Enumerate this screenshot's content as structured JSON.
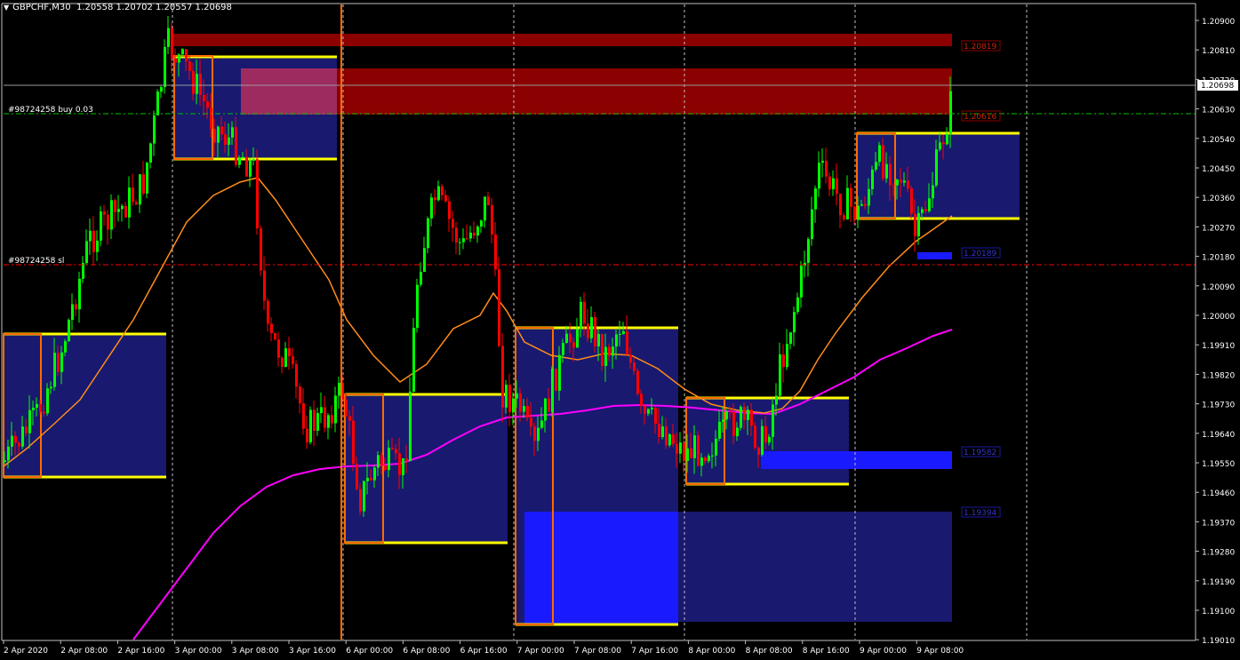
{
  "header": {
    "symbol_timeframe": "GBPCHF,M30",
    "ohlc": "1.20558 1.20702 1.20557 1.20698",
    "dropdown_glyph": "▼"
  },
  "price_scale": {
    "labels": [
      "1.20900",
      "1.20810",
      "1.20720",
      "1.20630",
      "1.20540",
      "1.20450",
      "1.20360",
      "1.20270",
      "1.20180",
      "1.20090",
      "1.20000",
      "1.19910",
      "1.19820",
      "1.19730",
      "1.19640",
      "1.19550",
      "1.19460",
      "1.19370",
      "1.19280",
      "1.19190",
      "1.19100",
      "1.19010"
    ],
    "current_price": "1.20698"
  },
  "time_scale": {
    "labels": [
      "2 Apr 2020",
      "2 Apr 08:00",
      "2 Apr 16:00",
      "3 Apr 00:00",
      "3 Apr 08:00",
      "3 Apr 16:00",
      "6 Apr 00:00",
      "6 Apr 08:00",
      "6 Apr 16:00",
      "7 Apr 00:00",
      "7 Apr 08:00",
      "7 Apr 16:00",
      "8 Apr 00:00",
      "8 Apr 08:00",
      "8 Apr 16:00",
      "9 Apr 00:00",
      "9 Apr 08:00"
    ]
  },
  "orders": {
    "buy_label": "#98724258 buy 0.03",
    "sl_label": "#98724258 sl"
  },
  "zone_labels": {
    "resistance_top": "1.20819",
    "resistance_mid": "1.20616",
    "support_small": "1.20189",
    "support_mid": "1.19582",
    "support_low": "1.19394"
  },
  "colors": {
    "background": "#000000",
    "bull_candle": "#00ff00",
    "bear_candle": "#ff0000",
    "resistance_zone": "#8b0000",
    "range_box": "#191970",
    "support_zone": "#1a1aff",
    "range_line": "#ffff00",
    "open_box": "#ff6a00",
    "ma_fast": "#ff8c1a",
    "ma_slow": "#ff00ff",
    "sl_line": "#ff0000",
    "buy_line": "#00c000"
  }
}
